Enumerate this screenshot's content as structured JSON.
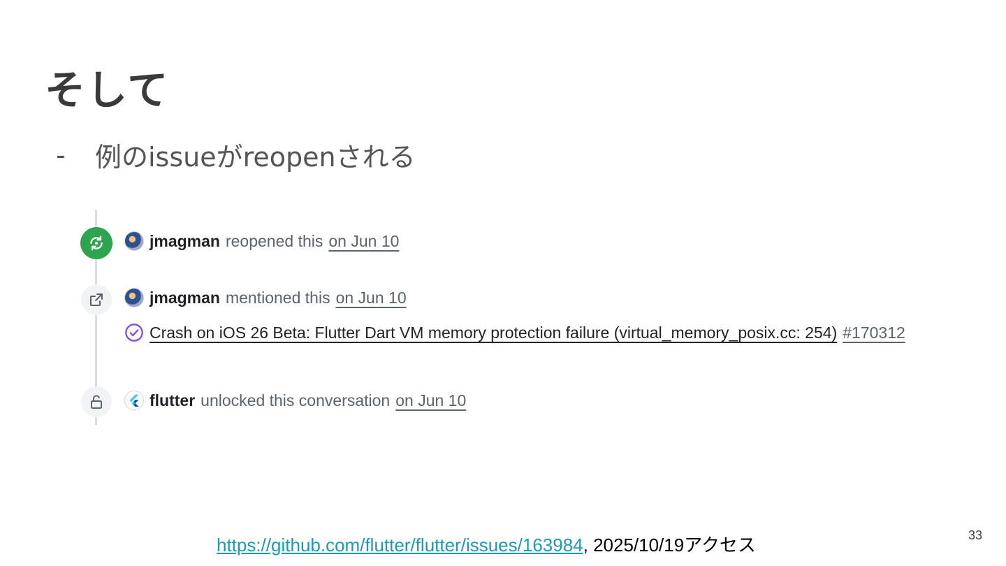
{
  "slide": {
    "title": "そして",
    "bullet_dash": "-",
    "bullet_text": "例のissueがreopenされる"
  },
  "timeline": {
    "events": [
      {
        "icon": "reopen-icon",
        "actor": "jmagman",
        "action": "reopened this",
        "date": "on Jun 10"
      },
      {
        "icon": "cross-reference-icon",
        "actor": "jmagman",
        "action": "mentioned this",
        "date": "on Jun 10",
        "reference": {
          "icon": "issue-closed-check-icon",
          "title": "Crash on iOS 26 Beta: Flutter Dart VM memory protection failure (virtual_memory_posix.cc: 254)",
          "number": "#170312"
        }
      },
      {
        "icon": "unlock-icon",
        "actor": "flutter",
        "action": "unlocked this conversation",
        "date": "on Jun 10"
      }
    ],
    "colors": {
      "reopen_badge": "#2da44e",
      "reference_icon": "#8250df",
      "timeline_line": "#d8dee4"
    }
  },
  "footer": {
    "url": "https://github.com/flutter/flutter/issues/163984",
    "suffix": ", 2025/10/19アクセス"
  },
  "page_number": "33"
}
